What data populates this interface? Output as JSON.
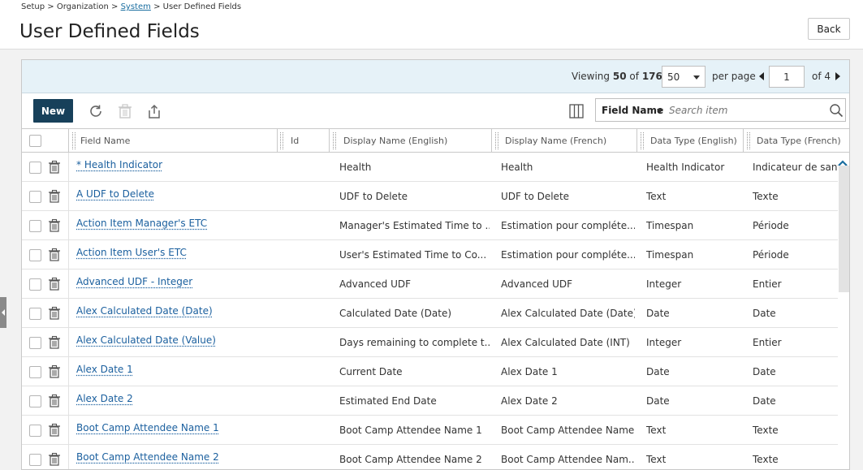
{
  "breadcrumb": {
    "setup": "Setup",
    "sep1": ">",
    "organization": "Organization",
    "sep2": ">",
    "system": "System",
    "sep3": ">",
    "current": "User Defined Fields"
  },
  "page": {
    "title": "User Defined Fields",
    "back_label": "Back"
  },
  "pager": {
    "viewing_label": "Viewing",
    "viewing_count": "50",
    "of_label": "of",
    "total": "176",
    "per_page_value": "50",
    "per_page_label": "per page",
    "current_page": "1",
    "of_pages": "of 4"
  },
  "toolbar": {
    "new_label": "New",
    "icons": [
      "refresh-icon",
      "delete-icon",
      "export-icon",
      "columns-icon"
    ],
    "search_field": "Field Name",
    "search_placeholder": "Search item"
  },
  "columns": [
    "Field Name",
    "Id",
    "Display Name (English)",
    "Display Name (French)",
    "Data Type (English)",
    "Data Type (French)"
  ],
  "rows": [
    {
      "field_name": "* Health Indicator",
      "id": "",
      "display_en": "Health",
      "display_fr": "Health",
      "type_en": "Health Indicator",
      "type_fr": "Indicateur de santé"
    },
    {
      "field_name": "A UDF to Delete",
      "id": "",
      "display_en": "UDF to Delete",
      "display_fr": "UDF to Delete",
      "type_en": "Text",
      "type_fr": "Texte"
    },
    {
      "field_name": "Action Item Manager's ETC",
      "id": "",
      "display_en": "Manager's Estimated Time to ...",
      "display_fr": "Estimation pour compléte...",
      "type_en": "Timespan",
      "type_fr": "Période"
    },
    {
      "field_name": "Action Item User's ETC",
      "id": "",
      "display_en": "User's Estimated Time to Co...",
      "display_fr": "Estimation pour compléte...",
      "type_en": "Timespan",
      "type_fr": "Période"
    },
    {
      "field_name": "Advanced UDF - Integer",
      "id": "",
      "display_en": "Advanced UDF",
      "display_fr": "Advanced UDF",
      "type_en": "Integer",
      "type_fr": "Entier"
    },
    {
      "field_name": "Alex Calculated Date (Date)",
      "id": "",
      "display_en": "Calculated Date (Date)",
      "display_fr": "Alex Calculated Date (Date)",
      "type_en": "Date",
      "type_fr": "Date"
    },
    {
      "field_name": "Alex Calculated Date (Value)",
      "id": "",
      "display_en": "Days remaining to complete t...",
      "display_fr": "Alex Calculated Date (INT)",
      "type_en": "Integer",
      "type_fr": "Entier"
    },
    {
      "field_name": "Alex Date 1",
      "id": "",
      "display_en": "Current Date",
      "display_fr": "Alex Date 1",
      "type_en": "Date",
      "type_fr": "Date"
    },
    {
      "field_name": "Alex Date 2",
      "id": "",
      "display_en": "Estimated End Date",
      "display_fr": "Alex Date 2",
      "type_en": "Date",
      "type_fr": "Date"
    },
    {
      "field_name": "Boot Camp Attendee Name 1",
      "id": "",
      "display_en": "Boot Camp Attendee Name 1",
      "display_fr": "Boot Camp Attendee Name",
      "type_en": "Text",
      "type_fr": "Texte"
    },
    {
      "field_name": "Boot Camp Attendee Name 2",
      "id": "",
      "display_en": "Boot Camp Attendee Name 2",
      "display_fr": "Boot Camp Attendee Nam...",
      "type_en": "Text",
      "type_fr": "Texte"
    }
  ]
}
